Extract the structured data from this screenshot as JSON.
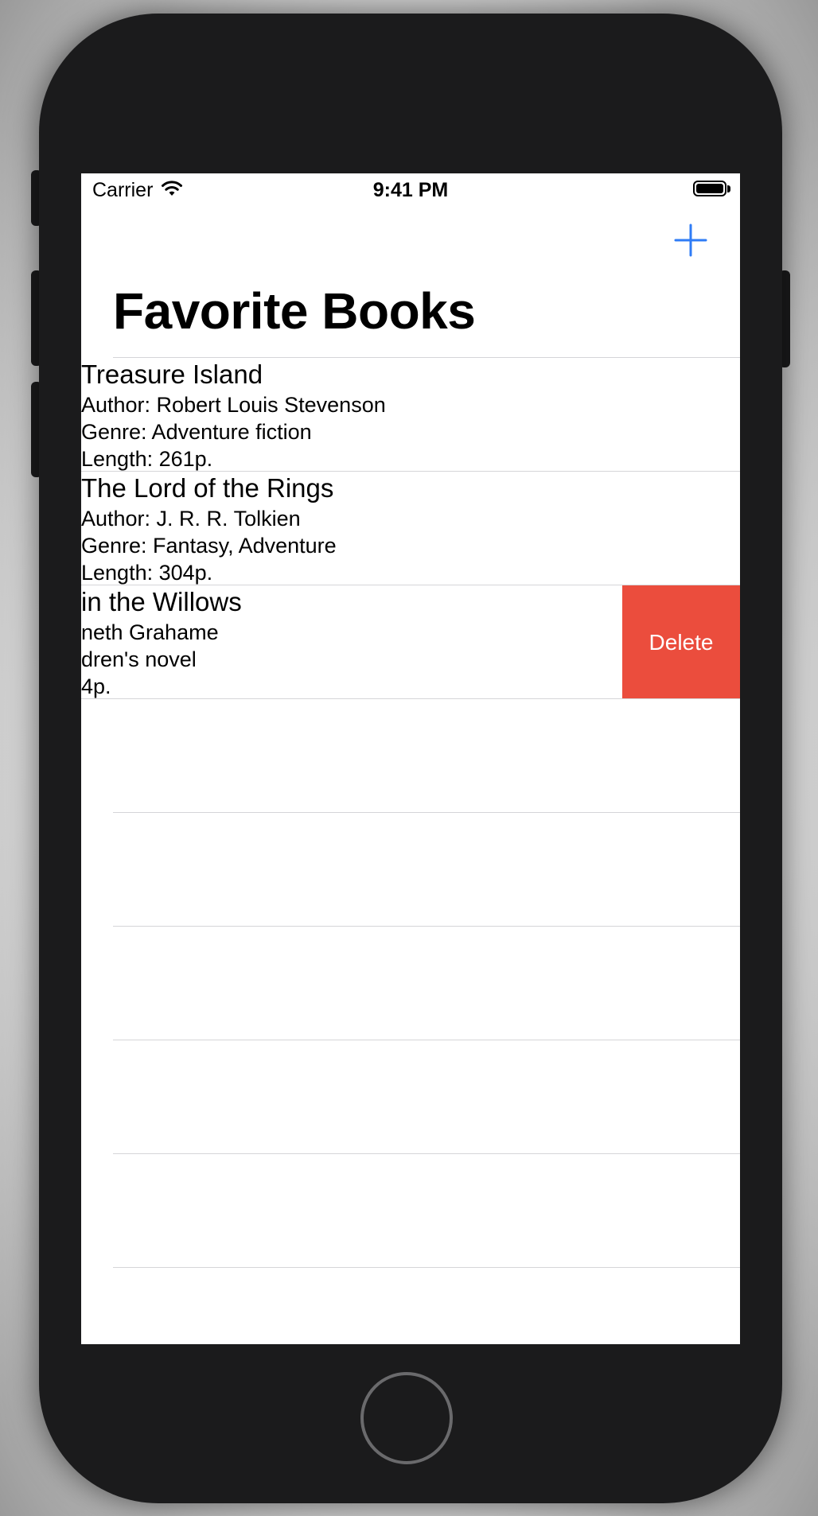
{
  "status_bar": {
    "carrier": "Carrier",
    "time": "9:41 PM",
    "wifi_icon": "wifi-icon",
    "battery_icon": "battery-full-icon"
  },
  "nav": {
    "add_icon": "plus-icon",
    "accent_color": "#2f7cf6",
    "title": "Favorite Books"
  },
  "books": [
    {
      "title": "Treasure Island",
      "author": "Author: Robert Louis Stevenson",
      "genre": "Genre:  Adventure fiction",
      "length": "Length: 261p."
    },
    {
      "title": "The Lord of the Rings",
      "author": "Author: J. R. R. Tolkien",
      "genre": "Genre:  Fantasy, Adventure",
      "length": "Length: 304p."
    },
    {
      "title": " in the Willows",
      "author": "neth Grahame",
      "genre": "dren's novel",
      "length": "4p."
    }
  ],
  "swipe_action": {
    "label": "Delete",
    "color": "#eb4d3d"
  }
}
